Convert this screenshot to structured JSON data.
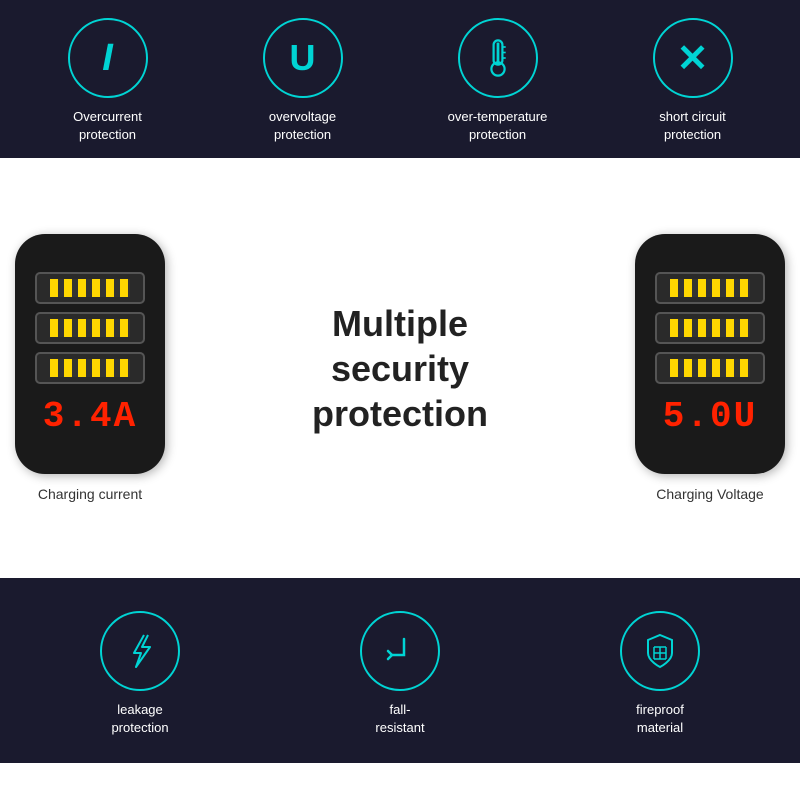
{
  "topSection": {
    "features": [
      {
        "id": "overcurrent",
        "symbol": "I",
        "line1": "Overcurrent",
        "line2": "protection"
      },
      {
        "id": "overvoltage",
        "symbol": "U",
        "line1": "overvoltage",
        "line2": "protection"
      },
      {
        "id": "overtemperature",
        "symbol": "thermometer",
        "line1": "over-temperature",
        "line2": "protection"
      },
      {
        "id": "shortcircuit",
        "symbol": "X",
        "line1": "short circuit",
        "line2": "protection"
      }
    ]
  },
  "middleSection": {
    "leftDevice": {
      "displayValue": "3.4A",
      "label": "Charging current"
    },
    "rightDevice": {
      "displayValue": "5.0U",
      "label": "Charging Voltage"
    },
    "centerText": {
      "line1": "Multiple",
      "line2": "security",
      "line3": "protection"
    }
  },
  "bottomSection": {
    "features": [
      {
        "id": "leakage",
        "iconType": "bolt",
        "line1": "leakage",
        "line2": "protection"
      },
      {
        "id": "fallresistant",
        "iconType": "arrow-down",
        "line1": "fall-",
        "line2": "resistant"
      },
      {
        "id": "fireproof",
        "iconType": "shield",
        "line1": "fireproof",
        "line2": "material"
      }
    ]
  }
}
